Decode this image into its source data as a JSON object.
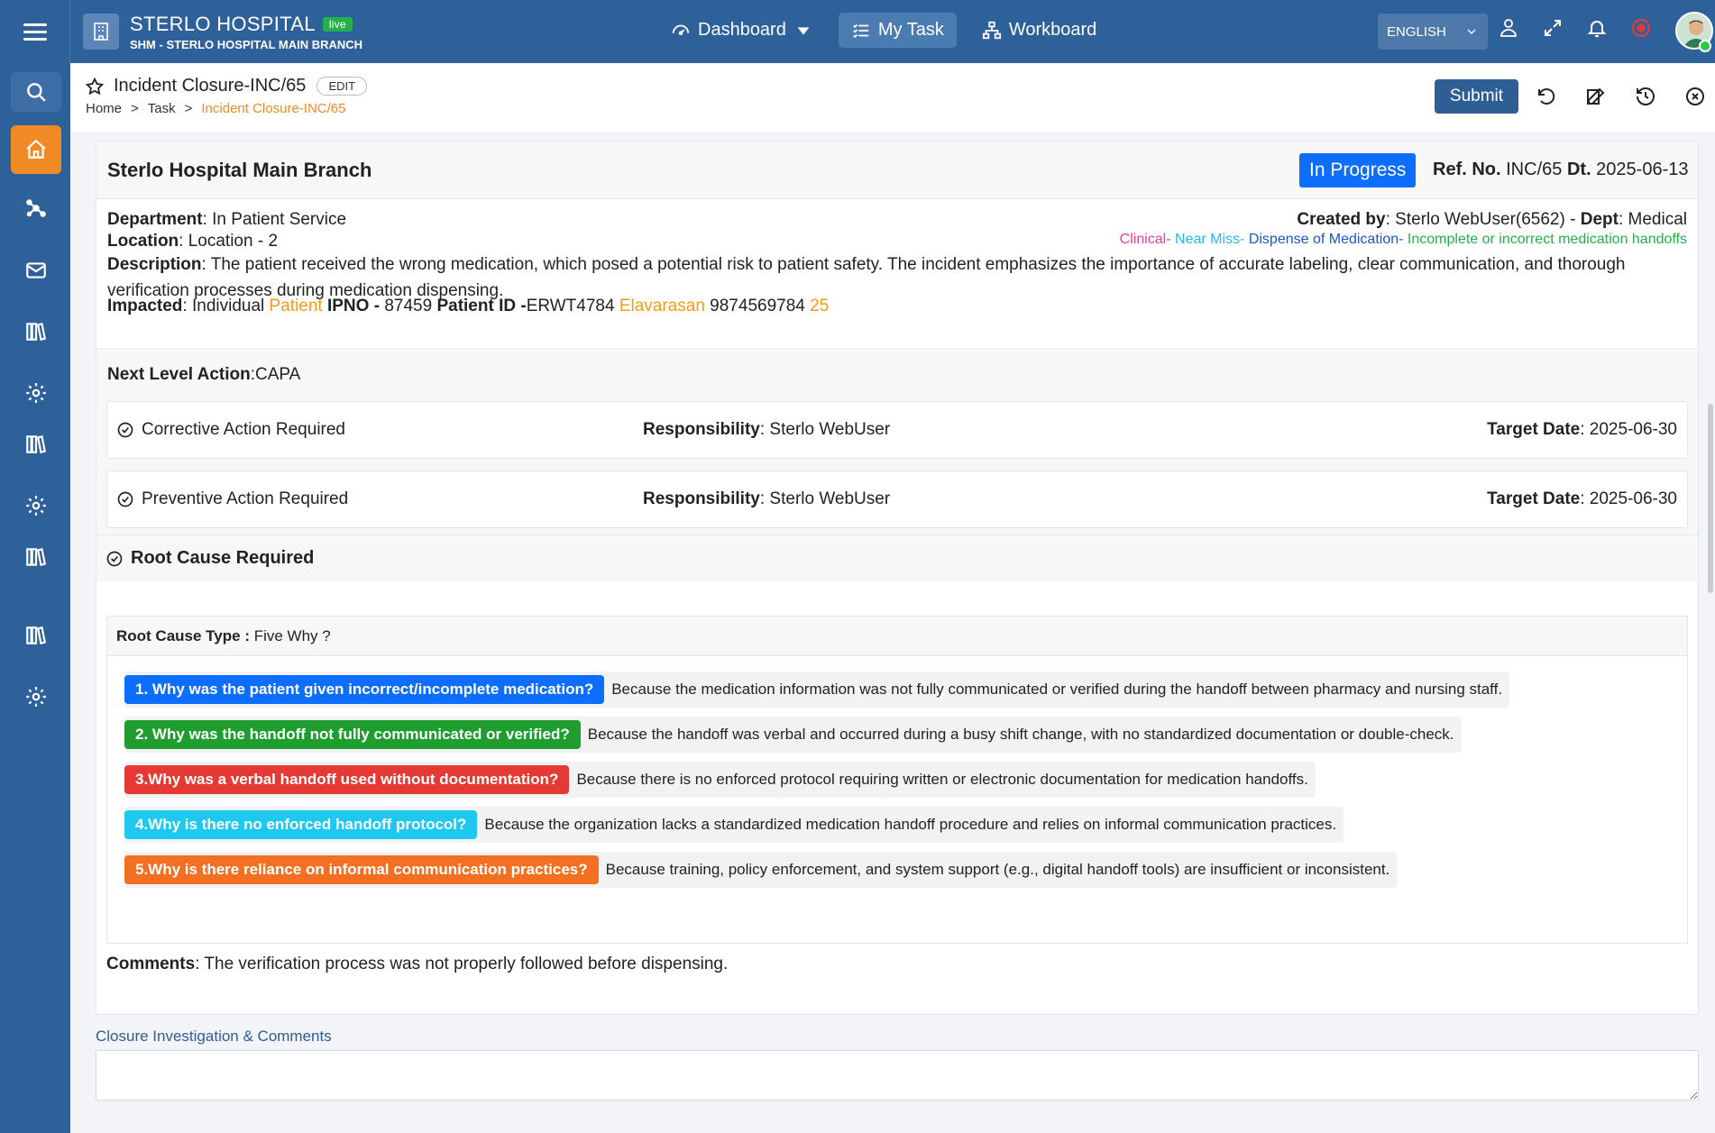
{
  "app": {
    "title": "STERLO HOSPITAL",
    "live_badge": "live",
    "subtitle": "SHM - STERLO HOSPITAL MAIN BRANCH"
  },
  "topnav": {
    "dashboard": "Dashboard",
    "my_task": "My Task",
    "workboard": "Workboard"
  },
  "language": "ENGLISH",
  "colors": {
    "primary": "#2e6199",
    "accent": "#f08a24",
    "status": "#0d6efd"
  },
  "page": {
    "title": "Incident Closure-INC/65",
    "edit_label": "EDIT",
    "breadcrumb": [
      "Home",
      "Task",
      "Incident Closure-INC/65"
    ],
    "submit_label": "Submit"
  },
  "incident": {
    "branch": "Sterlo Hospital Main Branch",
    "status": "In Progress",
    "ref_label": "Ref. No.",
    "ref_no": "INC/65",
    "dt_label": "Dt.",
    "date": "2025-06-13",
    "department_label": "Department",
    "department": "In Patient Service",
    "location_label": "Location",
    "location": "Location - 2",
    "created_by_label": "Created by",
    "created_by": "Sterlo WebUser(6562)",
    "dept_label": "Dept",
    "dept": "Medical",
    "tags": [
      "Clinical-",
      "Near Miss-",
      "Dispense of Medication-",
      "Incomplete or incorrect medication handoffs"
    ],
    "description_label": "Description",
    "description": "The patient received the wrong medication, which posed a potential risk to patient safety. The incident emphasizes the importance of accurate labeling, clear communication, and thorough verification processes during medication dispensing.",
    "impacted_label": "Impacted",
    "impacted_type": "Individual",
    "impacted_category": "Patient",
    "ipno_label": "IPNO -",
    "ipno": "87459",
    "patient_id_label": "Patient ID -",
    "patient_id": "ERWT4784",
    "patient_name": "Elavarasan",
    "phone": "9874569784",
    "age": "25"
  },
  "next_level": {
    "label": "Next Level Action",
    "value": "CAPA"
  },
  "actions": [
    {
      "label": "Corrective Action Required",
      "resp_label": "Responsibility",
      "responsibility": "Sterlo WebUser",
      "date_label": "Target Date",
      "target_date": "2025-06-30"
    },
    {
      "label": "Preventive Action Required",
      "resp_label": "Responsibility",
      "responsibility": "Sterlo WebUser",
      "date_label": "Target Date",
      "target_date": "2025-06-30"
    }
  ],
  "root_cause": {
    "heading": "Root Cause Required",
    "type_label": "Root Cause Type :",
    "type_value": "Five Why ?",
    "whys": [
      {
        "q": "1. Why was the patient given incorrect/incomplete medication?",
        "a": "Because the medication information was not fully communicated or verified during the handoff between pharmacy and nursing staff.",
        "color": "#0d6efd"
      },
      {
        "q": "2. Why was the handoff not fully communicated or verified?",
        "a": "Because the handoff was verbal and occurred during a busy shift change, with no standardized documentation or double-check.",
        "color": "#1e9e2f"
      },
      {
        "q": "3.Why was a verbal handoff used without documentation?",
        "a": "Because there is no enforced protocol requiring written or electronic documentation for medication handoffs.",
        "color": "#e53935"
      },
      {
        "q": "4.Why is there no enforced handoff protocol?",
        "a": "Because the organization lacks a standardized medication handoff procedure and relies on informal communication practices.",
        "color": "#1ec8ef"
      },
      {
        "q": "5.Why is there reliance on informal communication practices?",
        "a": "Because training, policy enforcement, and system support (e.g., digital handoff tools) are insufficient or inconsistent.",
        "color": "#f36f21"
      }
    ]
  },
  "comments": {
    "label": "Comments",
    "value": "The verification process was not properly followed before dispensing."
  },
  "closure": {
    "label": "Closure Investigation & Comments",
    "value": ""
  }
}
